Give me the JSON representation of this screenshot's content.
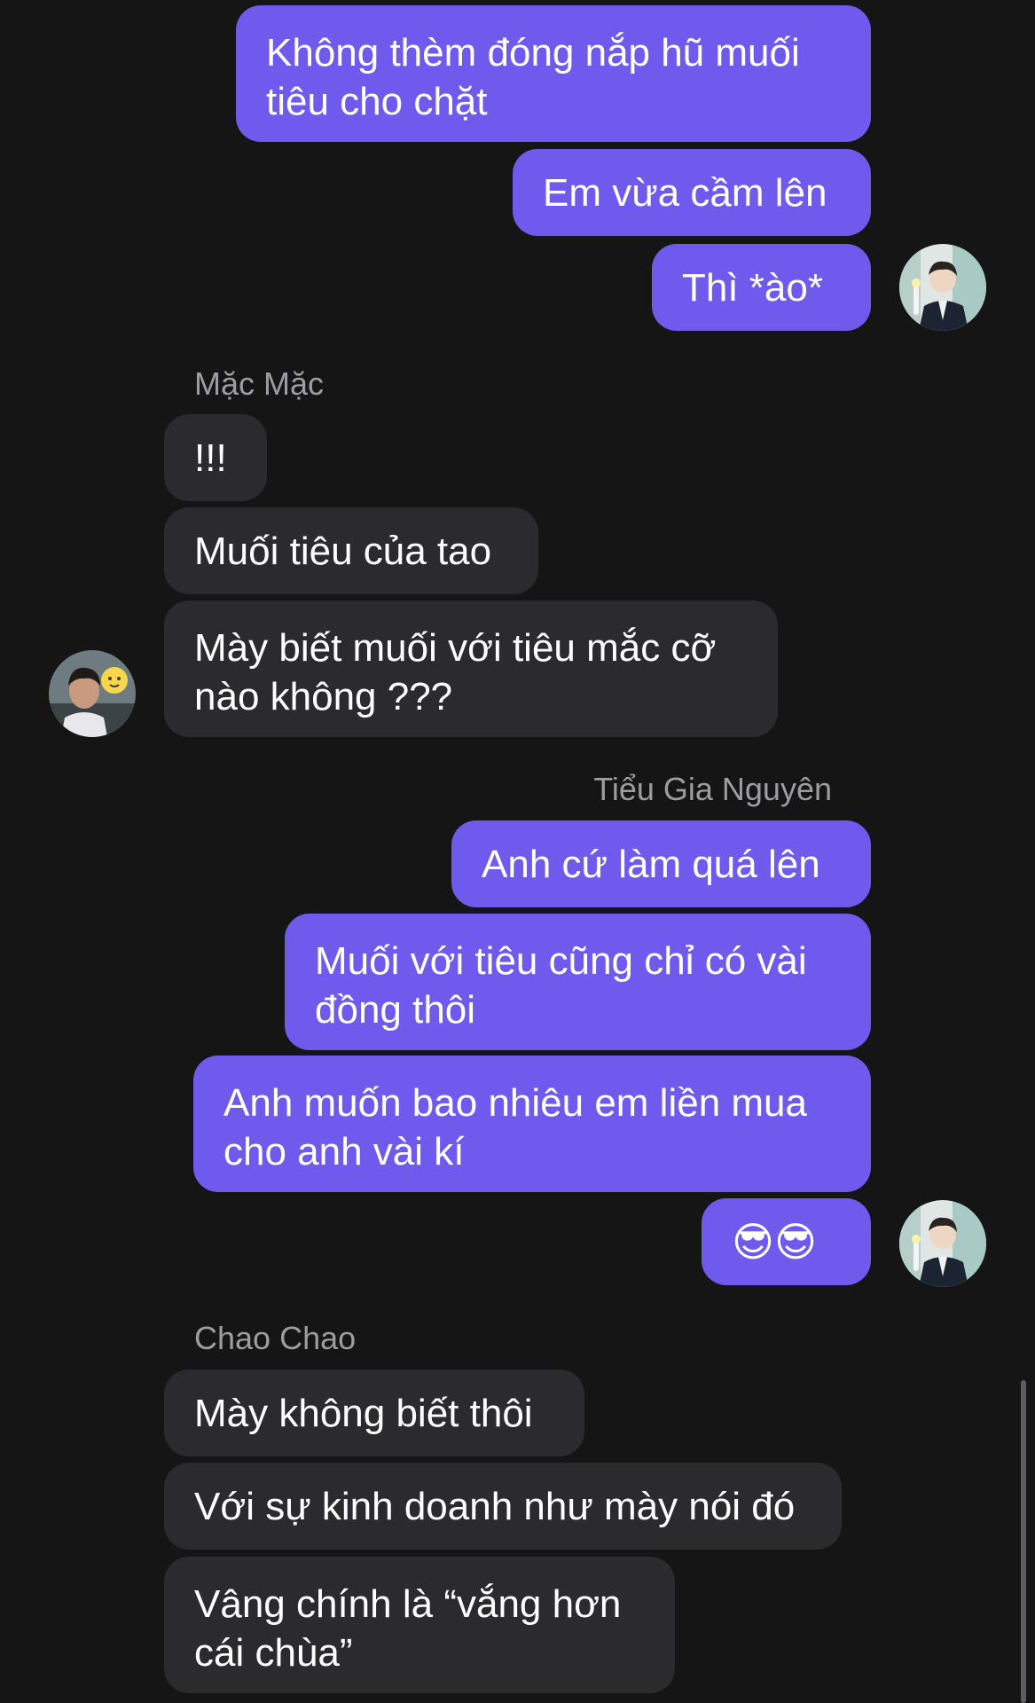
{
  "messages": {
    "m1": "Không thèm đóng nắp hũ muối tiêu cho chặt",
    "m2": "Em vừa cầm lên",
    "m3": "Thì *ào*",
    "sender1": "Mặc Mặc",
    "m4": "!!!",
    "m5": "Muối tiêu của tao",
    "m6": "Mày biết muối với tiêu mắc cỡ nào không ???",
    "sender2": "Tiểu Gia Nguyên",
    "m7": "Anh cứ làm quá lên",
    "m8": "Muối với tiêu cũng chỉ có vài đồng thôi",
    "m9": "Anh muốn bao nhiêu em liền mua cho anh vài kí",
    "m10": "😎😎",
    "sender3": "Chao Chao",
    "m11": "Mày không biết thôi",
    "m12": "Với sự kinh doanh như mày nói đó",
    "m13": "Vâng chính là “vắng hơn cái chùa”"
  },
  "colors": {
    "background": "#151515",
    "outgoing_bubble": "#6f5aed",
    "incoming_bubble": "#2b2b2d",
    "sender_name": "#9c9ca1"
  }
}
